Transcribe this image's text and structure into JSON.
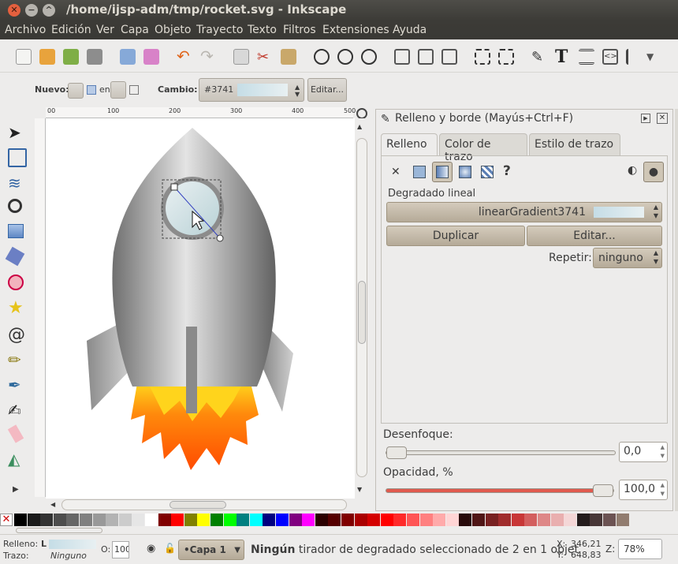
{
  "window": {
    "title": "/home/ijsp-adm/tmp/rocket.svg - Inkscape"
  },
  "menu": [
    "Archivo",
    "Edición",
    "Ver",
    "Capa",
    "Objeto",
    "Trayecto",
    "Texto",
    "Filtros",
    "Extensiones",
    "Ayuda"
  ],
  "commands": [
    "new-document-icon",
    "open-icon",
    "save-icon",
    "print-icon",
    "import-icon",
    "export-icon",
    "undo-icon",
    "redo-icon",
    "copy-icon",
    "cut-icon",
    "paste-icon",
    "zoom-selection-icon",
    "zoom-drawing-icon",
    "zoom-page-icon",
    "duplicate-icon",
    "clone-icon",
    "unlink-clone-icon",
    "group-icon",
    "ungroup-icon",
    "fill-stroke-icon",
    "text-icon",
    "layers-icon",
    "xml-editor-icon",
    "align-icon"
  ],
  "gradient_toolbar": {
    "new_label": "Nuevo:",
    "on_label": "en",
    "change_label": "Cambio:",
    "gradient_id": "#3741",
    "edit_button": "Editar..."
  },
  "ruler": {
    "ticks": [
      "00",
      "100",
      "200",
      "300",
      "400",
      "500"
    ]
  },
  "tools": [
    "selector-icon",
    "node-icon",
    "tweak-icon",
    "zoom-icon",
    "rectangle-icon",
    "box3d-icon",
    "ellipse-icon",
    "star-icon",
    "spiral-icon",
    "pencil-icon",
    "pen-icon",
    "calligraphy-icon",
    "eraser-icon",
    "paint-bucket-icon"
  ],
  "panel": {
    "title": "Relleno y borde (Mayús+Ctrl+F)",
    "tabs": [
      "Relleno",
      "Color de trazo",
      "Estilo de trazo"
    ],
    "paint_types": [
      "no-paint-icon",
      "flat-color-icon",
      "linear-gradient-icon",
      "radial-gradient-icon",
      "pattern-icon",
      "unset-icon"
    ],
    "paint_mode_label": "Degradado lineal",
    "gradient_name": "linearGradient3741",
    "duplicate_button": "Duplicar",
    "edit_button": "Editar...",
    "repeat_label": "Repetir:",
    "repeat_value": "ninguno",
    "blur_label": "Desenfoque:",
    "blur_value": "0,0",
    "blur_level": 0,
    "opacity_label": "Opacidad, %",
    "opacity_value": "100,0",
    "opacity_level": 100
  },
  "palette": [
    "#000000",
    "#1a1a1a",
    "#333333",
    "#4d4d4d",
    "#666666",
    "#808080",
    "#999999",
    "#b3b3b3",
    "#cccccc",
    "#e6e6e6",
    "#ffffff",
    "#800000",
    "#ff0000",
    "#808000",
    "#ffff00",
    "#008000",
    "#00ff00",
    "#008080",
    "#00ffff",
    "#000080",
    "#0000ff",
    "#800080",
    "#ff00ff",
    "#2b0000",
    "#550000",
    "#800000",
    "#aa0000",
    "#d40000",
    "#ff0000",
    "#ff2a2a",
    "#ff5555",
    "#ff8080",
    "#ffaaaa",
    "#ffd5d5",
    "#280b0b",
    "#501616",
    "#782121",
    "#a02c2c",
    "#c83737",
    "#d35f5f",
    "#de8787",
    "#e9afaf",
    "#f4d7d7",
    "#241c1c",
    "#483737",
    "#6c5353",
    "#917c6f"
  ],
  "status": {
    "fill_label": "Relleno:",
    "fill_value": "L",
    "stroke_label": "Trazo:",
    "stroke_value": "Ninguno",
    "opacity_label": "O:",
    "opacity_value": "100",
    "layer": "•Capa 1",
    "message_bold": "Ningún",
    "message_rest": " tirador de degradado seleccionado de 2 en 1 objet",
    "x_label": "X:",
    "x_value": "346,21",
    "y_label": "Y:",
    "y_value": "648,83",
    "zoom_label": "Z:",
    "zoom_value": "78%"
  }
}
